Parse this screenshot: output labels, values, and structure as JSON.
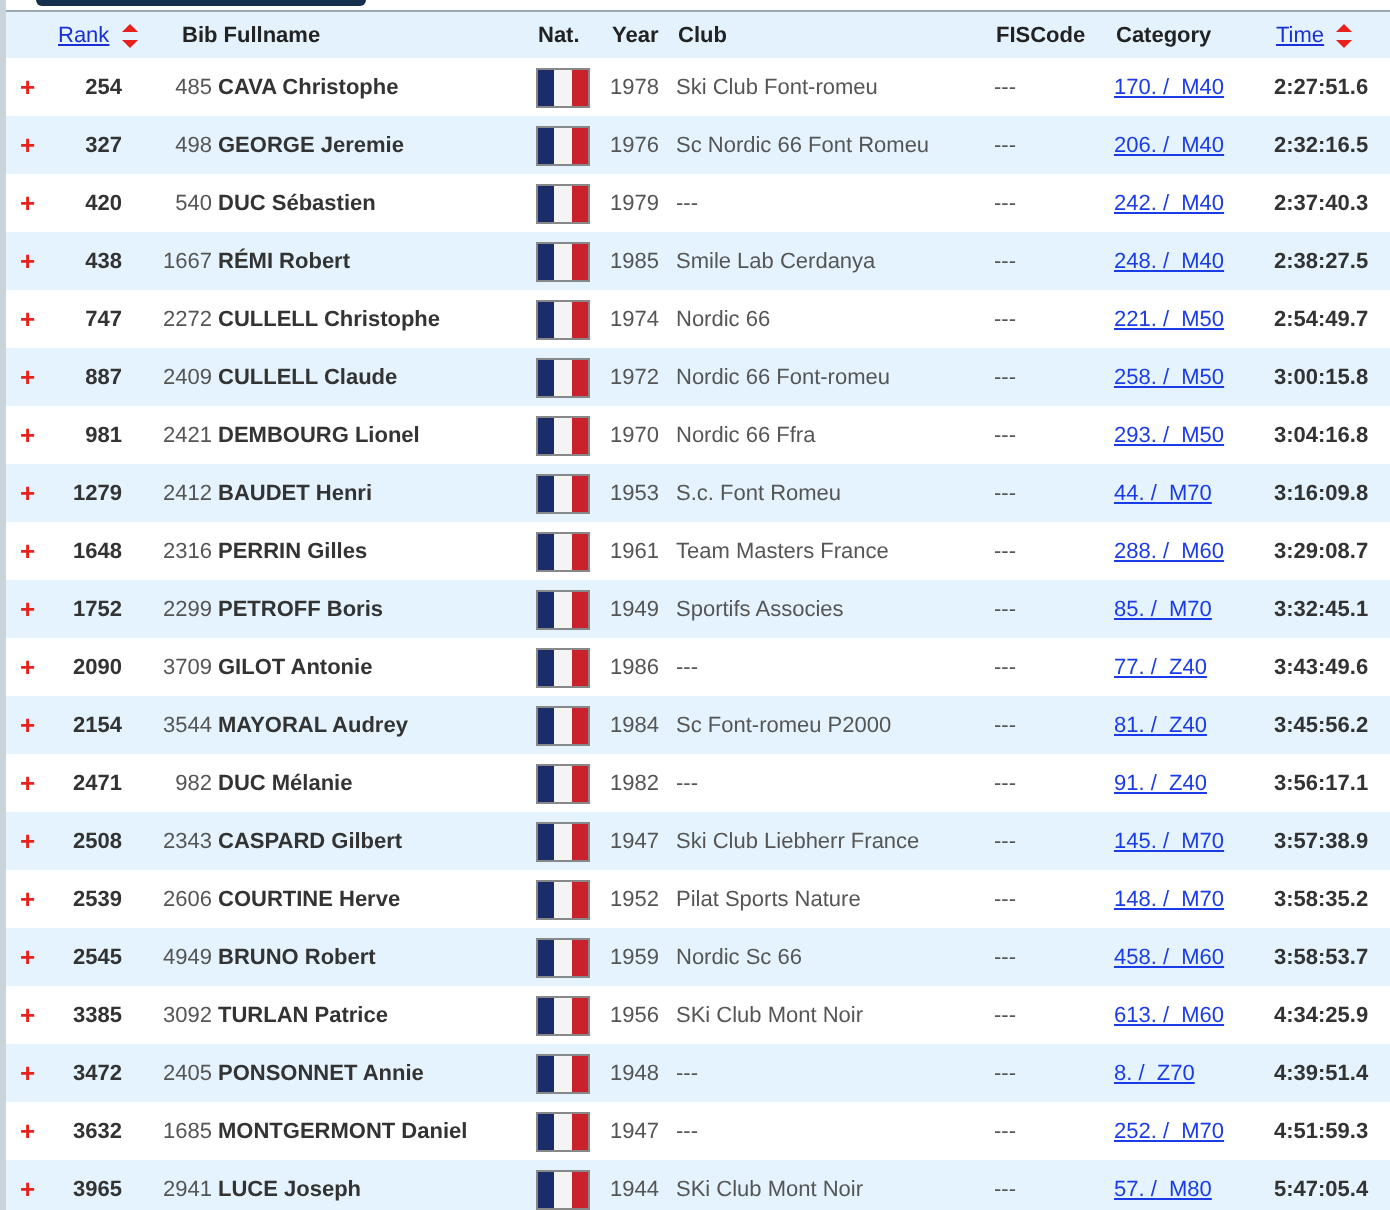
{
  "columns": [
    {
      "label": "Rank",
      "sortable": true
    },
    {
      "label": "Bib Fullname",
      "sortable": false
    },
    {
      "label": "Nat.",
      "sortable": false
    },
    {
      "label": "Year",
      "sortable": false
    },
    {
      "label": "Club",
      "sortable": false
    },
    {
      "label": "FISCode",
      "sortable": false
    },
    {
      "label": "Category",
      "sortable": false
    },
    {
      "label": "Time",
      "sortable": true
    }
  ],
  "rows": [
    {
      "toggle": "+",
      "rank": "254",
      "bib": "485",
      "name": "CAVA Christophe",
      "year": "1978",
      "club": "Ski Club Font-romeu",
      "fiscode": "---",
      "category": "170. /  M40",
      "time": "2:27:51.6"
    },
    {
      "toggle": "+",
      "rank": "327",
      "bib": "498",
      "name": "GEORGE Jeremie",
      "year": "1976",
      "club": "Sc Nordic 66 Font Romeu",
      "fiscode": "---",
      "category": "206. /  M40",
      "time": "2:32:16.5"
    },
    {
      "toggle": "+",
      "rank": "420",
      "bib": "540",
      "name": "DUC Sébastien",
      "year": "1979",
      "club": "---",
      "fiscode": "---",
      "category": "242. /  M40",
      "time": "2:37:40.3"
    },
    {
      "toggle": "+",
      "rank": "438",
      "bib": "1667",
      "name": "RÉMI Robert",
      "year": "1985",
      "club": "Smile Lab Cerdanya",
      "fiscode": "---",
      "category": "248. /  M40",
      "time": "2:38:27.5"
    },
    {
      "toggle": "+",
      "rank": "747",
      "bib": "2272",
      "name": "CULLELL Christophe",
      "year": "1974",
      "club": "Nordic 66",
      "fiscode": "---",
      "category": "221. /  M50",
      "time": "2:54:49.7"
    },
    {
      "toggle": "+",
      "rank": "887",
      "bib": "2409",
      "name": "CULLELL Claude",
      "year": "1972",
      "club": "Nordic 66 Font-romeu",
      "fiscode": "---",
      "category": "258. /  M50",
      "time": "3:00:15.8"
    },
    {
      "toggle": "+",
      "rank": "981",
      "bib": "2421",
      "name": "DEMBOURG Lionel",
      "year": "1970",
      "club": "Nordic 66 Ffra",
      "fiscode": "---",
      "category": "293. /  M50",
      "time": "3:04:16.8"
    },
    {
      "toggle": "+",
      "rank": "1279",
      "bib": "2412",
      "name": "BAUDET Henri",
      "year": "1953",
      "club": "S.c. Font Romeu",
      "fiscode": "---",
      "category": "44. /  M70",
      "time": "3:16:09.8"
    },
    {
      "toggle": "+",
      "rank": "1648",
      "bib": "2316",
      "name": "PERRIN Gilles",
      "year": "1961",
      "club": "Team Masters France",
      "fiscode": "---",
      "category": "288. /  M60",
      "time": "3:29:08.7"
    },
    {
      "toggle": "+",
      "rank": "1752",
      "bib": "2299",
      "name": "PETROFF Boris",
      "year": "1949",
      "club": "Sportifs Associes",
      "fiscode": "---",
      "category": "85. /  M70",
      "time": "3:32:45.1"
    },
    {
      "toggle": "+",
      "rank": "2090",
      "bib": "3709",
      "name": "GILOT Antonie",
      "year": "1986",
      "club": "---",
      "fiscode": "---",
      "category": "77. /  Z40",
      "time": "3:43:49.6"
    },
    {
      "toggle": "+",
      "rank": "2154",
      "bib": "3544",
      "name": "MAYORAL Audrey",
      "year": "1984",
      "club": "Sc Font-romeu P2000",
      "fiscode": "---",
      "category": "81. /  Z40",
      "time": "3:45:56.2"
    },
    {
      "toggle": "+",
      "rank": "2471",
      "bib": "982",
      "name": "DUC Mélanie",
      "year": "1982",
      "club": "---",
      "fiscode": "---",
      "category": "91. /  Z40",
      "time": "3:56:17.1"
    },
    {
      "toggle": "+",
      "rank": "2508",
      "bib": "2343",
      "name": "CASPARD Gilbert",
      "year": "1947",
      "club": "Ski Club Liebherr France",
      "fiscode": "---",
      "category": "145. /  M70",
      "time": "3:57:38.9"
    },
    {
      "toggle": "+",
      "rank": "2539",
      "bib": "2606",
      "name": "COURTINE Herve",
      "year": "1952",
      "club": "Pilat Sports Nature",
      "fiscode": "---",
      "category": "148. /  M70",
      "time": "3:58:35.2"
    },
    {
      "toggle": "+",
      "rank": "2545",
      "bib": "4949",
      "name": "BRUNO Robert",
      "year": "1959",
      "club": "Nordic Sc 66",
      "fiscode": "---",
      "category": "458. /  M60",
      "time": "3:58:53.7"
    },
    {
      "toggle": "+",
      "rank": "3385",
      "bib": "3092",
      "name": "TURLAN Patrice",
      "year": "1956",
      "club": "SKi Club Mont Noir",
      "fiscode": "---",
      "category": "613. /  M60",
      "time": "4:34:25.9"
    },
    {
      "toggle": "+",
      "rank": "3472",
      "bib": "2405",
      "name": "PONSONNET Annie",
      "year": "1948",
      "club": "---",
      "fiscode": "---",
      "category": "8. /  Z70",
      "time": "4:39:51.4"
    },
    {
      "toggle": "+",
      "rank": "3632",
      "bib": "1685",
      "name": "MONTGERMONT Daniel",
      "year": "1947",
      "club": "---",
      "fiscode": "---",
      "category": "252. /  M70",
      "time": "4:51:59.3"
    },
    {
      "toggle": "+",
      "rank": "3965",
      "bib": "2941",
      "name": "LUCE Joseph",
      "year": "1944",
      "club": "SKi Club Mont Noir",
      "fiscode": "---",
      "category": "57. /  M80",
      "time": "5:47:05.4"
    }
  ]
}
